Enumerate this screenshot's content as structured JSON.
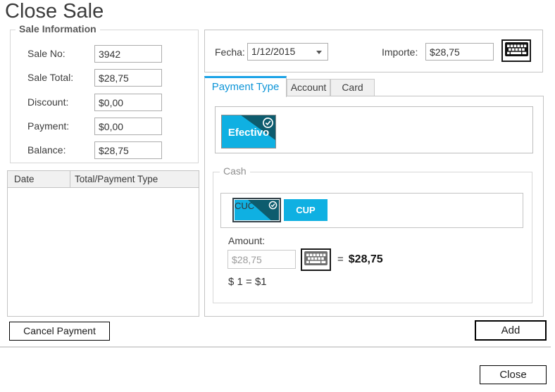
{
  "title": "Close Sale",
  "sale_info": {
    "legend": "Sale Information",
    "fields": [
      {
        "label": "Sale No:",
        "value": "3942"
      },
      {
        "label": "Sale Total:",
        "value": "$28,75"
      },
      {
        "label": "Discount:",
        "value": "$0,00"
      },
      {
        "label": "Payment:",
        "value": "$0,00"
      },
      {
        "label": "Balance:",
        "value": "$28,75"
      }
    ]
  },
  "payments_table": {
    "columns": [
      "Date",
      "Total/Payment Type"
    ],
    "rows": []
  },
  "payment_header": {
    "fecha_label": "Fecha:",
    "fecha_value": "1/12/2015",
    "importe_label": "Importe:",
    "importe_value": "$28,75"
  },
  "tabs": [
    {
      "label": "Payment Type",
      "active": true
    },
    {
      "label": "Account",
      "active": false
    },
    {
      "label": "Card",
      "active": false
    }
  ],
  "payment_type": {
    "method_label": "Efectivo",
    "method_selected": true
  },
  "cash": {
    "legend": "Cash",
    "currencies": [
      {
        "label": "CUC",
        "selected": true
      },
      {
        "label": "CUP",
        "selected": false
      }
    ],
    "amount_label": "Amount:",
    "amount_value": "$28,75",
    "equals_sign": "=",
    "converted_value": "$28,75",
    "exchange_rate": "$ 1 = $1"
  },
  "buttons": {
    "cancel_payment": "Cancel Payment",
    "add": "Add",
    "close": "Close"
  },
  "icons": [
    "keyboard-icon",
    "check-circle-icon",
    "dropdown-arrow-icon"
  ],
  "colors": {
    "accent_cyan": "#0fb0e2",
    "accent_teal": "#0d5c6e",
    "tab_active_text": "#0e95d8",
    "tab_active_line": "#19a2e6"
  }
}
